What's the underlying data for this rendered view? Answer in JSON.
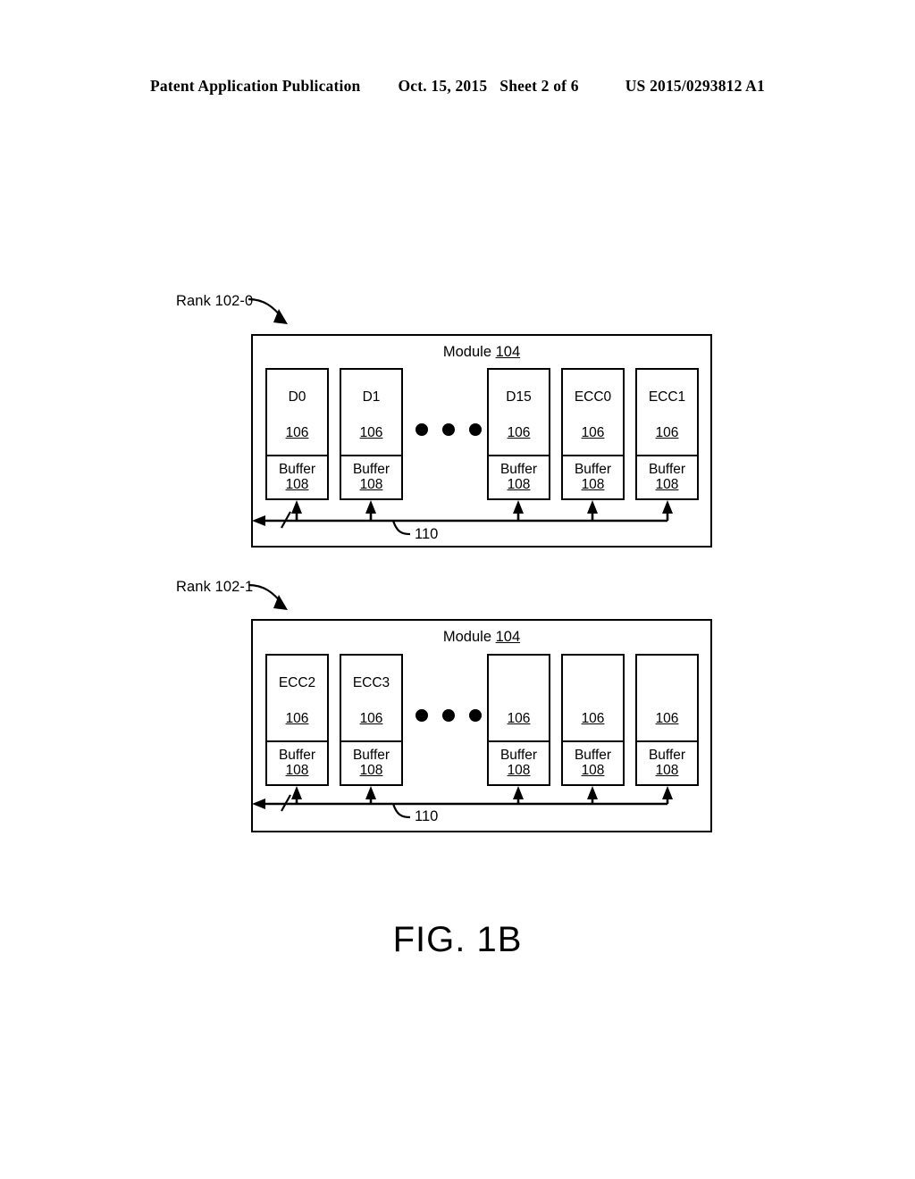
{
  "header": {
    "publication": "Patent Application Publication",
    "date": "Oct. 15, 2015",
    "sheet": "Sheet 2 of 6",
    "document_number": "US 2015/0293812 A1"
  },
  "figure": {
    "caption": "FIG. 1B",
    "ellipsis_dot_count": 3,
    "line_color": "#000000",
    "background_color": "#ffffff",
    "ranks": [
      {
        "rank_label": "Rank 102-0",
        "module_title_text": "Module",
        "module_ref": "104",
        "bus_ref": "110",
        "chips": [
          {
            "name": "D0",
            "ref": "106",
            "buffer_label": "Buffer",
            "buffer_ref": "108"
          },
          {
            "name": "D1",
            "ref": "106",
            "buffer_label": "Buffer",
            "buffer_ref": "108"
          },
          {
            "name": "D15",
            "ref": "106",
            "buffer_label": "Buffer",
            "buffer_ref": "108"
          },
          {
            "name": "ECC0",
            "ref": "106",
            "buffer_label": "Buffer",
            "buffer_ref": "108"
          },
          {
            "name": "ECC1",
            "ref": "106",
            "buffer_label": "Buffer",
            "buffer_ref": "108"
          }
        ]
      },
      {
        "rank_label": "Rank 102-1",
        "module_title_text": "Module",
        "module_ref": "104",
        "bus_ref": "110",
        "chips": [
          {
            "name": "ECC2",
            "ref": "106",
            "buffer_label": "Buffer",
            "buffer_ref": "108"
          },
          {
            "name": "ECC3",
            "ref": "106",
            "buffer_label": "Buffer",
            "buffer_ref": "108"
          },
          {
            "name": "",
            "ref": "106",
            "buffer_label": "Buffer",
            "buffer_ref": "108"
          },
          {
            "name": "",
            "ref": "106",
            "buffer_label": "Buffer",
            "buffer_ref": "108"
          },
          {
            "name": "",
            "ref": "106",
            "buffer_label": "Buffer",
            "buffer_ref": "108"
          }
        ]
      }
    ]
  }
}
